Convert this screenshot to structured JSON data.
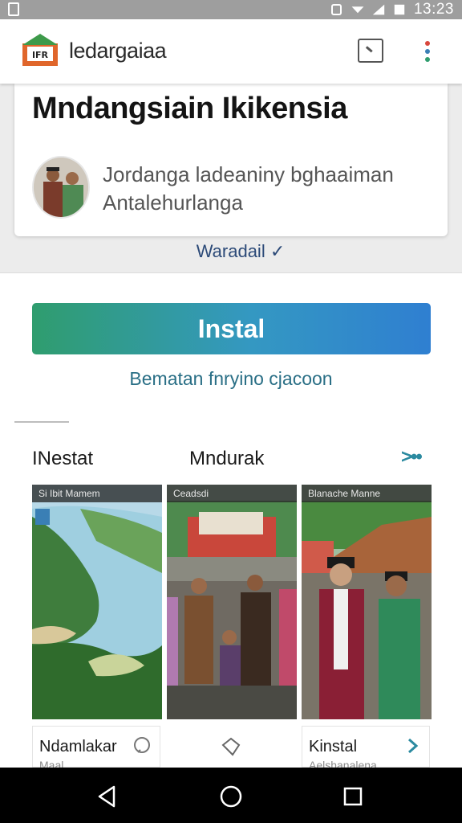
{
  "status_bar": {
    "time": "13:23"
  },
  "app_bar": {
    "logo_text": "IFR",
    "title": "ledargaiaa",
    "cast_icon": "cast-icon",
    "more_icon": "more-vert-icon"
  },
  "card": {
    "title": "Mndangsiain Ikikensia",
    "description": "Jordanga ladeaniny bghaaiman Antalehurlanga"
  },
  "more_link": "Waradail ✓",
  "install_button": "Instal",
  "sub_link": "Bematan fnryino cjacoon",
  "section": {
    "left_label": "INestat",
    "mid_label": "Mndurak",
    "arrow": ">••"
  },
  "screenshots": [
    {
      "caption": "Si Ibit Mamem"
    },
    {
      "caption": "Ceadsdi"
    },
    {
      "caption": "Blanache Manne"
    }
  ],
  "tiles": [
    {
      "name": "Ndamlakar",
      "sub": "Maal"
    },
    {
      "name": "",
      "sub": ""
    },
    {
      "name": "Kinstal",
      "sub": "Aelshanalena"
    }
  ],
  "colors": {
    "install_start": "#2f9d6e",
    "install_end": "#2f7fd1",
    "link": "#2a6f86"
  }
}
